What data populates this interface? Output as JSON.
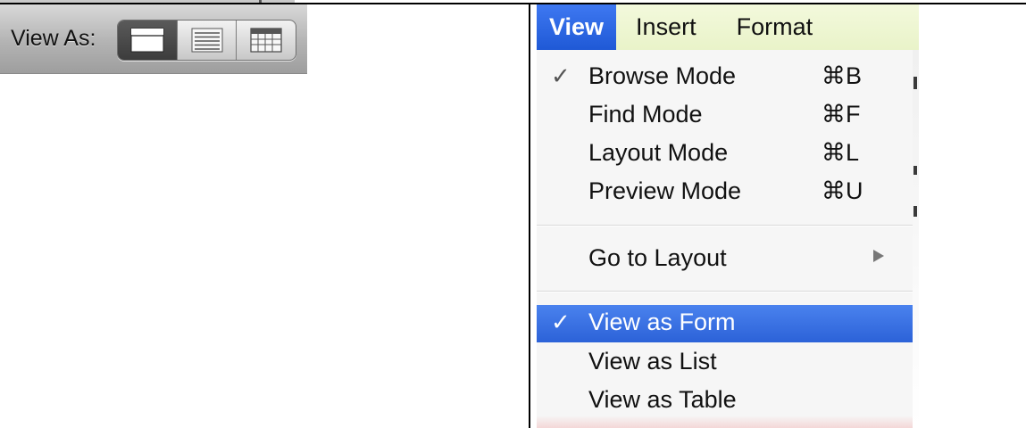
{
  "view_as_toolbar": {
    "label": "View As:",
    "buttons": [
      {
        "icon": "form-view-icon",
        "active": true
      },
      {
        "icon": "list-view-icon",
        "active": false
      },
      {
        "icon": "table-view-icon",
        "active": false
      }
    ]
  },
  "menubar": {
    "items": [
      "View",
      "Insert",
      "Format"
    ],
    "active": "View"
  },
  "view_menu": {
    "mode_items": [
      {
        "label": "Browse Mode",
        "shortcut": "⌘B",
        "checked": true
      },
      {
        "label": "Find Mode",
        "shortcut": "⌘F",
        "checked": false
      },
      {
        "label": "Layout Mode",
        "shortcut": "⌘L",
        "checked": false
      },
      {
        "label": "Preview Mode",
        "shortcut": "⌘U",
        "checked": false
      }
    ],
    "goto_item": {
      "label": "Go to Layout",
      "submenu_icon": "submenu-arrow-icon"
    },
    "view_as_items": [
      {
        "label": "View as Form",
        "checked": true,
        "highlighted": true
      },
      {
        "label": "View as List",
        "checked": false,
        "highlighted": false
      },
      {
        "label": "View as Table",
        "checked": false,
        "highlighted": false
      }
    ],
    "check_glyph": "✓",
    "submenu_glyph": "▶"
  },
  "colors": {
    "menu_highlight": "#2c62d8",
    "menubar_bg": "#eef6d2",
    "toolbar_bg": "#b3b3b3"
  }
}
